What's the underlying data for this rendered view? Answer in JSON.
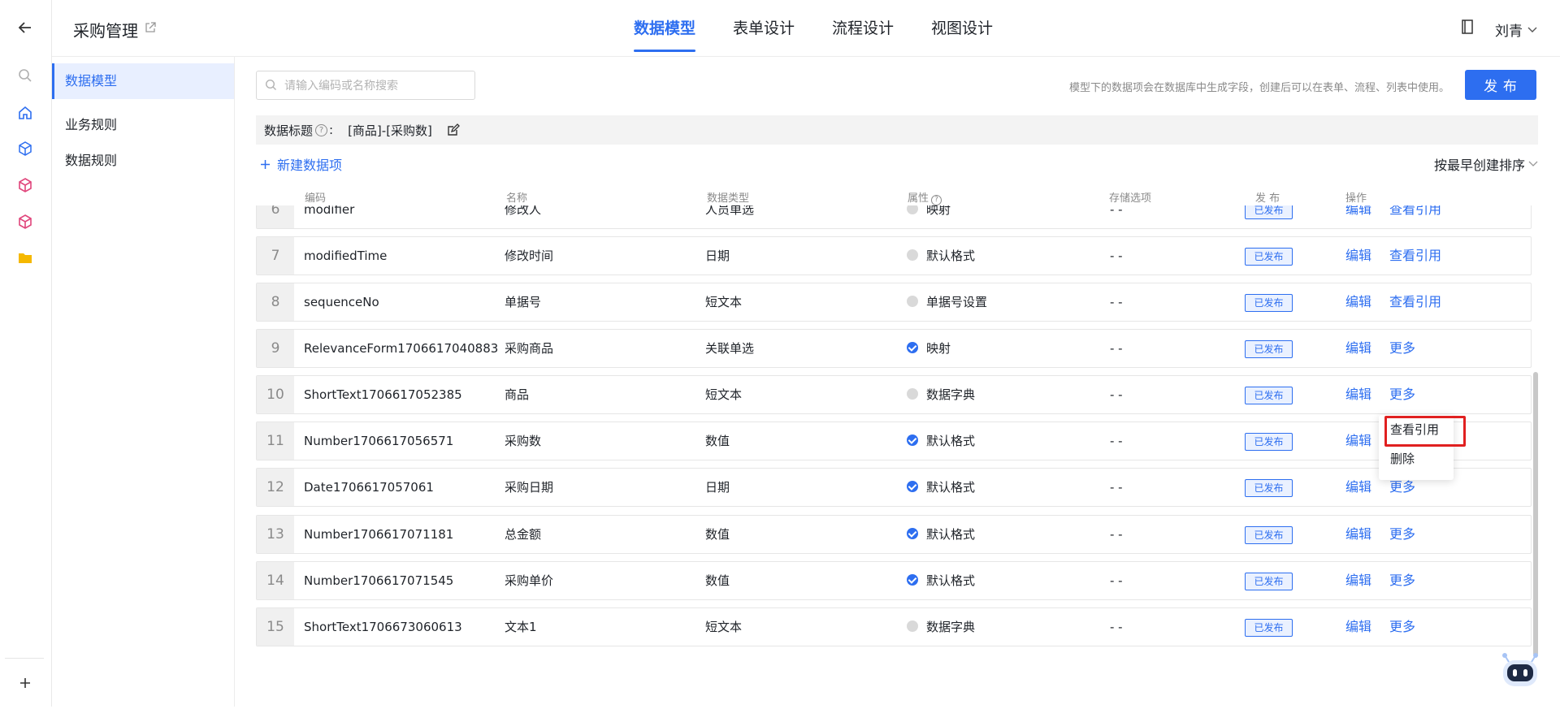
{
  "header": {
    "app_title": "采购管理",
    "tabs": [
      "数据模型",
      "表单设计",
      "流程设计",
      "视图设计"
    ],
    "user_name": "刘青"
  },
  "subnav": {
    "items": [
      "数据模型",
      "业务规则",
      "数据规则"
    ]
  },
  "toolbar": {
    "search_placeholder": "请输入编码或名称搜索",
    "hint": "模型下的数据项会在数据库中生成字段，创建后可以在表单、流程、列表中使用。",
    "publish_label": "发 布"
  },
  "title_bar": {
    "label": "数据标题",
    "colon": ":",
    "value": "[商品]-[采购数]"
  },
  "actions": {
    "new_item": "新建数据项",
    "sort": "按最早创建排序"
  },
  "table": {
    "columns": [
      "编码",
      "名称",
      "数据类型",
      "属性",
      "存储选项",
      "发 布",
      "操作"
    ],
    "rows": [
      {
        "idx": "6",
        "code": "modifier",
        "name": "修改人",
        "type": "人员单选",
        "attr": "映射",
        "attr_on": false,
        "storage": "- -",
        "status": "已发布",
        "edit": "编辑",
        "more": "查看引用"
      },
      {
        "idx": "7",
        "code": "modifiedTime",
        "name": "修改时间",
        "type": "日期",
        "attr": "默认格式",
        "attr_on": false,
        "storage": "- -",
        "status": "已发布",
        "edit": "编辑",
        "more": "查看引用"
      },
      {
        "idx": "8",
        "code": "sequenceNo",
        "name": "单据号",
        "type": "短文本",
        "attr": "单据号设置",
        "attr_on": false,
        "storage": "- -",
        "status": "已发布",
        "edit": "编辑",
        "more": "查看引用"
      },
      {
        "idx": "9",
        "code": "RelevanceForm1706617040883",
        "name": "采购商品",
        "type": "关联单选",
        "attr": "映射",
        "attr_on": true,
        "storage": "- -",
        "status": "已发布",
        "edit": "编辑",
        "more": "更多"
      },
      {
        "idx": "10",
        "code": "ShortText1706617052385",
        "name": "商品",
        "type": "短文本",
        "attr": "数据字典",
        "attr_on": false,
        "storage": "- -",
        "status": "已发布",
        "edit": "编辑",
        "more": "更多"
      },
      {
        "idx": "11",
        "code": "Number1706617056571",
        "name": "采购数",
        "type": "数值",
        "attr": "默认格式",
        "attr_on": true,
        "storage": "- -",
        "status": "已发布",
        "edit": "编辑",
        "more": ""
      },
      {
        "idx": "12",
        "code": "Date1706617057061",
        "name": "采购日期",
        "type": "日期",
        "attr": "默认格式",
        "attr_on": true,
        "storage": "- -",
        "status": "已发布",
        "edit": "编辑",
        "more": "更多"
      },
      {
        "idx": "13",
        "code": "Number1706617071181",
        "name": "总金额",
        "type": "数值",
        "attr": "默认格式",
        "attr_on": true,
        "storage": "- -",
        "status": "已发布",
        "edit": "编辑",
        "more": "更多"
      },
      {
        "idx": "14",
        "code": "Number1706617071545",
        "name": "采购单价",
        "type": "数值",
        "attr": "默认格式",
        "attr_on": true,
        "storage": "- -",
        "status": "已发布",
        "edit": "编辑",
        "more": "更多"
      },
      {
        "idx": "15",
        "code": "ShortText1706673060613",
        "name": "文本1",
        "type": "短文本",
        "attr": "数据字典",
        "attr_on": false,
        "storage": "- -",
        "status": "已发布",
        "edit": "编辑",
        "more": "更多"
      }
    ]
  },
  "dropdown": {
    "items": [
      "查看引用",
      "删除"
    ]
  },
  "colors": {
    "accent": "#2d6ef0",
    "highlight": "#e02020",
    "rail_icon": "#e0457b",
    "folder": "#f5b800"
  }
}
